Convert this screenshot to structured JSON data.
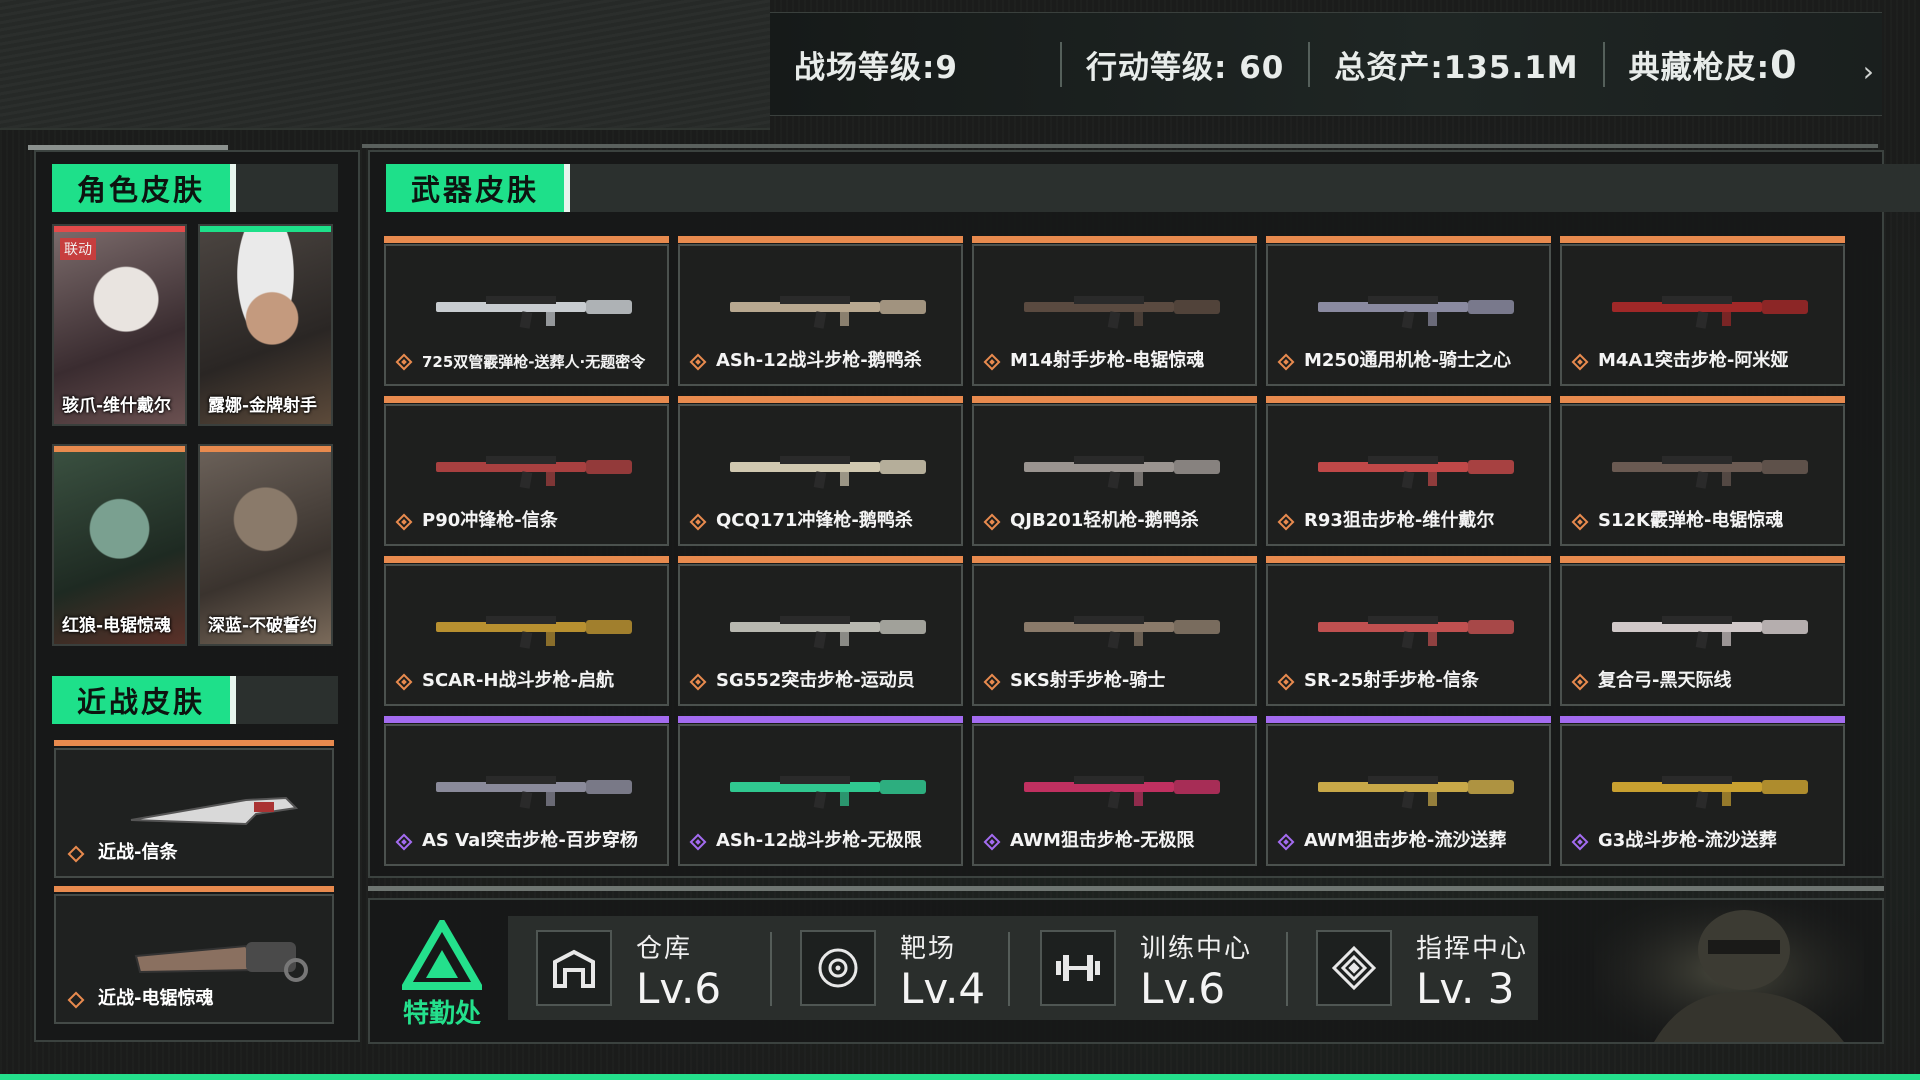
{
  "stats": {
    "battlefield_level": "战场等级:9",
    "operation_level": "行动等级: 60",
    "total_assets": "总资产:135.1M",
    "collection_skins_label": "典藏枪皮:",
    "collection_skins_value": "0",
    "arrow": "›"
  },
  "character_skins": {
    "title": "角色皮肤",
    "items": [
      {
        "label": "骇爪-维什戴尔",
        "collab": "联动",
        "stripe": "#e34a4a"
      },
      {
        "label": "露娜-金牌射手",
        "stripe": "#1ee08a"
      },
      {
        "label": "红狼-电锯惊魂",
        "stripe": "#e88a4e"
      },
      {
        "label": "深蓝-不破誓约",
        "stripe": "#e88a4e"
      }
    ]
  },
  "melee_skins": {
    "title": "近战皮肤",
    "items": [
      {
        "label": "近战-信条"
      },
      {
        "label": "近战-电锯惊魂"
      }
    ]
  },
  "weapon_skins": {
    "title": "武器皮肤",
    "items": [
      {
        "label": "725双管霰弹枪-送葬人·无题密令",
        "rarity": "gold"
      },
      {
        "label": "ASh-12战斗步枪-鹅鸭杀",
        "rarity": "gold"
      },
      {
        "label": "M14射手步枪-电锯惊魂",
        "rarity": "gold"
      },
      {
        "label": "M250通用机枪-骑士之心",
        "rarity": "gold"
      },
      {
        "label": "M4A1突击步枪-阿米娅",
        "rarity": "gold"
      },
      {
        "label": "P90冲锋枪-信条",
        "rarity": "gold"
      },
      {
        "label": "QCQ171冲锋枪-鹅鸭杀",
        "rarity": "gold"
      },
      {
        "label": "QJB201轻机枪-鹅鸭杀",
        "rarity": "gold"
      },
      {
        "label": "R93狙击步枪-维什戴尔",
        "rarity": "gold"
      },
      {
        "label": "S12K霰弹枪-电锯惊魂",
        "rarity": "gold"
      },
      {
        "label": "SCAR-H战斗步枪-启航",
        "rarity": "gold"
      },
      {
        "label": "SG552突击步枪-运动员",
        "rarity": "gold"
      },
      {
        "label": "SKS射手步枪-骑士",
        "rarity": "gold"
      },
      {
        "label": "SR-25射手步枪-信条",
        "rarity": "gold"
      },
      {
        "label": "复合弓-黑天际线",
        "rarity": "gold"
      },
      {
        "label": "AS Val突击步枪-百步穿杨",
        "rarity": "purple"
      },
      {
        "label": "ASh-12战斗步枪-无极限",
        "rarity": "purple"
      },
      {
        "label": "AWM狙击步枪-无极限",
        "rarity": "purple"
      },
      {
        "label": "AWM狙击步枪-流沙送葬",
        "rarity": "purple"
      },
      {
        "label": "G3战斗步枪-流沙送葬",
        "rarity": "purple"
      }
    ]
  },
  "agency": {
    "label": "特勤处"
  },
  "facilities": [
    {
      "name": "仓库",
      "level": "Lv.6",
      "icon": "warehouse-icon"
    },
    {
      "name": "靶场",
      "level": "Lv.4",
      "icon": "target-icon"
    },
    {
      "name": "训练中心",
      "level": "Lv.6",
      "icon": "dumbbell-icon"
    },
    {
      "name": "指挥中心",
      "level": "Lv. 3",
      "icon": "command-icon"
    }
  ],
  "colors": {
    "accent": "#1ee08a",
    "gold_rarity": "#e88a4e",
    "purple_rarity": "#a36bf0"
  }
}
